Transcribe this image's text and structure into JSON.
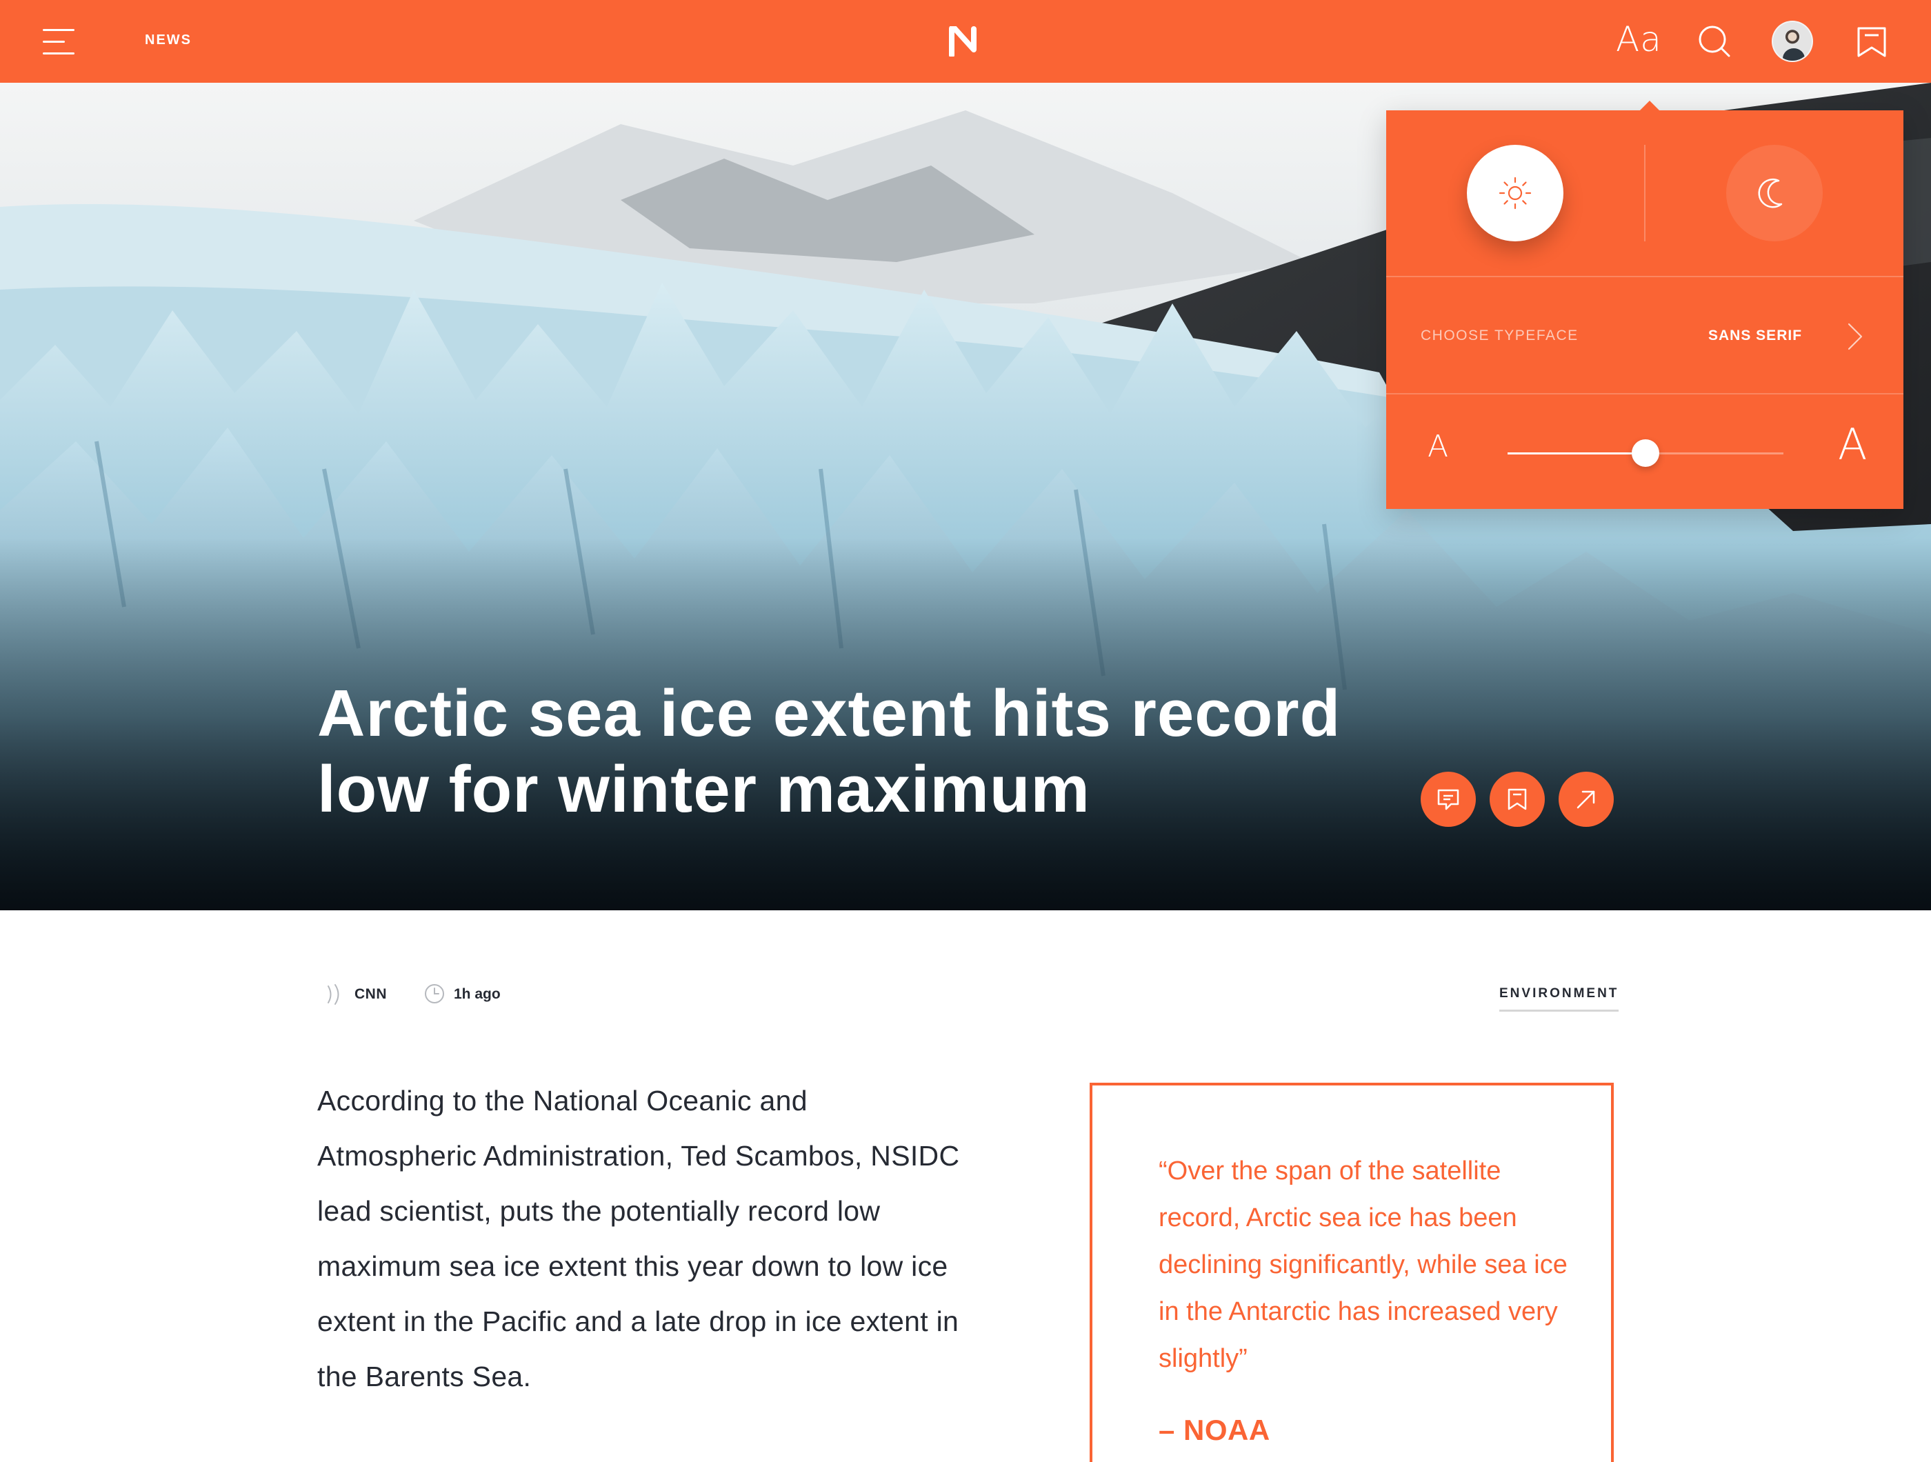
{
  "topbar": {
    "section_label": "NEWS",
    "logo_letter": "N",
    "font_settings_label": "Aa",
    "icons": [
      "menu-icon",
      "search-icon",
      "avatar",
      "bookmark-icon"
    ]
  },
  "hero": {
    "headline_line1": "Arctic sea ice extent hits record",
    "headline_line2": "low for winter maximum",
    "actions": [
      "comment-icon",
      "bookmark-icon",
      "share-icon"
    ]
  },
  "settings": {
    "modes": [
      "sun-icon",
      "moon-icon"
    ],
    "active_mode": "light",
    "typeface_label": "CHOOSE TYPEFACE",
    "typeface_value": "SANS SERIF",
    "size_small_glyph": "A",
    "size_large_glyph": "A",
    "text_size_level": 0.5
  },
  "meta": {
    "source": "CNN",
    "time": "1h ago",
    "category": "ENVIRONMENT"
  },
  "article": {
    "paragraph": "According to the National Oceanic and Atmospheric Administration, Ted Scambos, NSIDC lead scientist, puts the potentially record low maximum sea ice extent this year down to low ice extent in the Pacific and a late drop in ice extent in the Barents Sea.",
    "quote": "“Over the span of the satellite record, Arctic sea ice has been declining significantly, while sea ice in the Antarctic has increased very slightly”",
    "quote_attribution": "– NOAA"
  },
  "colors": {
    "accent": "#fa6434",
    "text": "#262a33",
    "background": "#ffffff"
  }
}
